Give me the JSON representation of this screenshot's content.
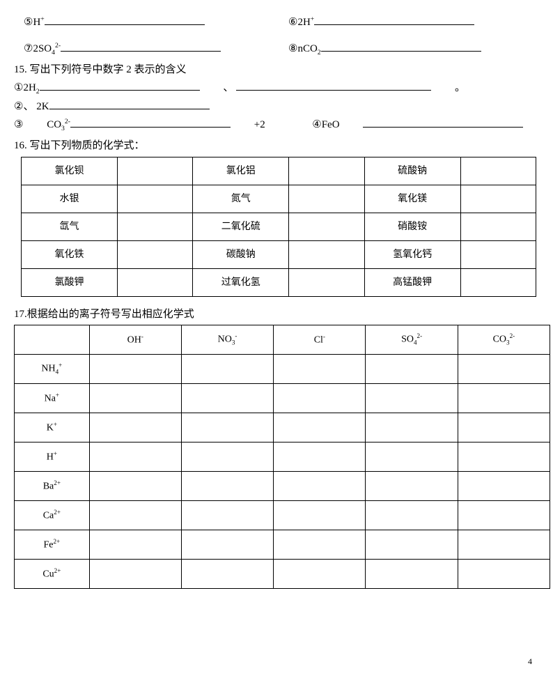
{
  "q14": {
    "item5": {
      "num": "⑤",
      "formula_html": "H<sup>+</sup>"
    },
    "item6": {
      "num": "⑥",
      "formula_html": "2H<sup>+</sup>"
    },
    "item7": {
      "num": "⑦",
      "formula_html": "2SO<sub>4</sub><sup>2-</sup>"
    },
    "item8": {
      "num": "⑧",
      "formula_html": "nCO<sub>2</sub>"
    }
  },
  "q15": {
    "title": "15. 写出下列符号中数字 2 表示的含义",
    "item1": {
      "num": "①",
      "formula_html": "2H<sub>2</sub>"
    },
    "sep1": "、",
    "period": "。",
    "item2": {
      "num": "②",
      "sep": "、",
      "formula_html": "2K"
    },
    "item3": {
      "num": "③",
      "formula_html": "CO<sub>3</sub><sup>2-</sup>",
      "suffix": "+2"
    },
    "item4": {
      "num": "④",
      "formula_html": "FeO"
    }
  },
  "q16": {
    "title": "16. 写出下列物质的化学式：",
    "rows": [
      [
        "氯化钡",
        "",
        "氯化铝",
        "",
        "硫酸钠",
        ""
      ],
      [
        "水银",
        "",
        "氮气",
        "",
        "氧化镁",
        ""
      ],
      [
        "氙气",
        "",
        "二氧化硫",
        "",
        "硝酸铵",
        ""
      ],
      [
        "氧化铁",
        "",
        "碳酸钠",
        "",
        "氢氧化钙",
        ""
      ],
      [
        "氯酸钾",
        "",
        "过氧化氢",
        "",
        "高锰酸钾",
        ""
      ]
    ]
  },
  "q17": {
    "title": "17.根据给出的离子符号写出相应化学式",
    "cols": [
      "",
      "OH<sup>-</sup>",
      "NO<sub>3</sub><sup>-</sup>",
      "Cl<sup>-</sup>",
      "SO<sub>4</sub><sup>2-</sup>",
      "CO<sub>3</sub><sup>2-</sup>"
    ],
    "rows": [
      "NH<sub>4</sub><sup>+</sup>",
      "Na<sup>+</sup>",
      "K<sup>+</sup>",
      "H<sup>+</sup>",
      "Ba<sup>2+</sup>",
      "Ca<sup>2+</sup>",
      "Fe<sup>2+</sup>",
      "Cu<sup>2+</sup>"
    ]
  },
  "page": "4"
}
